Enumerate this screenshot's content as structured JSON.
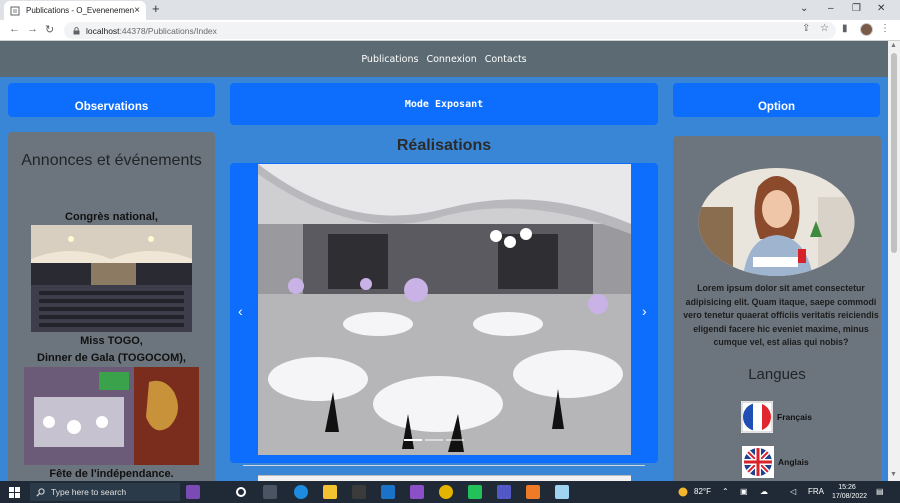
{
  "browser": {
    "tab_title": "Publications - O_Evenenement",
    "url_host": "localhost",
    "url_rest": ":44378/Publications/Index"
  },
  "nav": {
    "links": [
      "Publications",
      "Connexion",
      "Contacts"
    ]
  },
  "buttons": {
    "observations": "Observations",
    "mode_exposant": "Mode Exposant",
    "option": "Option"
  },
  "left_panel": {
    "title": "Annonces et événements",
    "events": [
      "Congrès national,",
      "Miss TOGO,",
      "Dinner de Gala (TOGOCOM),",
      "Fête de l'indépendance."
    ]
  },
  "center": {
    "title": "Réalisations",
    "carousel_active_index": 0,
    "carousel_count": 3
  },
  "right_panel": {
    "lorem": "Lorem ipsum dolor sit amet consectetur adipisicing elit. Quam itaque, saepe commodi vero tenetur quaerat officiis veritatis reiciendis eligendi facere hic eveniet maxime, minus cumque vel, est alias qui nobis?",
    "langues_title": "Langues",
    "languages": [
      "Français",
      "Anglais"
    ]
  },
  "taskbar": {
    "search_placeholder": "Type here to search",
    "weather": "82°F",
    "lang": "FRA",
    "time": "15:26",
    "date": "17/08/2022"
  }
}
